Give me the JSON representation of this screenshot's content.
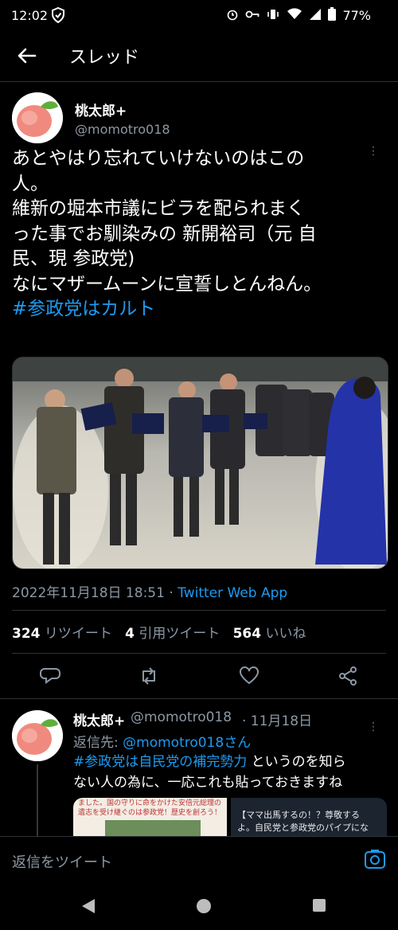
{
  "status": {
    "time": "12:02",
    "battery": "77%"
  },
  "header": {
    "title": "スレッド"
  },
  "tweet": {
    "name": "桃太郎+",
    "handle": "@momotro018",
    "lines": [
      "あとやはり忘れていけないのはこの",
      "人。",
      "維新の堀本市議にビラを配られまく",
      "った事でお馴染みの 新開裕司（元 自",
      "民、現 参政党)",
      "なにマザームーンに宣誓しとんねん。"
    ],
    "hashtag": "#参政党はカルト",
    "datetime": "2022年11月18日 18:51 · ",
    "app": "Twitter Web App",
    "stats": {
      "retweets": "324",
      "retweets_label": " リツイート",
      "quotes": "4",
      "quotes_label": " 引用ツイート",
      "likes": "564",
      "likes_label": " いいね"
    }
  },
  "reply": {
    "name": "桃太郎+",
    "handle": "@momotro018",
    "time": "· 11月18日",
    "to_label": "返信先: ",
    "to_handle": "@momotro018さん",
    "hashtag": "#参政党は自民党の補完勢力",
    "text1": " というのを知ら",
    "text2": "ない人の為に、一応これも貼っておきますね",
    "media_left": "ました。国の守りに命をかけた安倍元総理の遺志を受け継ぐのは参政党！歴史を創ろう！",
    "media_right_1": "【ママ出馬するの！？尊敬する",
    "media_right_2": "よ。自民党と参政党のパイプにな"
  },
  "composer": {
    "placeholder": "返信をツイート"
  },
  "colors": {
    "accent": "#1d9bf0",
    "muted": "#8b98a5",
    "bg": "#000000"
  }
}
